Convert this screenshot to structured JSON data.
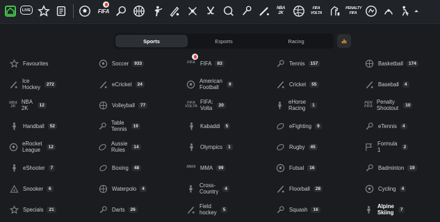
{
  "topbar": {
    "live_label": "LIVE",
    "nba_label": "NBA 2K",
    "fifa_label": "FIFA",
    "volta_label": "FIFA VOLTA",
    "penalty_label": "PENALTY FIFA"
  },
  "tabs": [
    {
      "label": "Sports",
      "active": true
    },
    {
      "label": "Esports",
      "active": false
    },
    {
      "label": "Racing",
      "active": false
    }
  ],
  "sports": [
    [
      {
        "name": "Favourites",
        "count": "",
        "icon": "star-icon"
      },
      {
        "name": "Ice Hockey",
        "count": "272",
        "icon": "ice-hockey-icon"
      },
      {
        "name": "NBA 2K",
        "count": "12",
        "icon": "nba-2k-icon"
      },
      {
        "name": "Handball",
        "count": "52",
        "icon": "handball-icon"
      },
      {
        "name": "eRocket League",
        "count": "12",
        "icon": "rocket-league-icon"
      },
      {
        "name": "eShooter",
        "count": "7",
        "icon": "shooter-icon"
      },
      {
        "name": "Snooker",
        "count": "6",
        "icon": "snooker-icon"
      },
      {
        "name": "Specials",
        "count": "21",
        "icon": "specials-icon"
      }
    ],
    [
      {
        "name": "Soccer",
        "count": "933",
        "icon": "soccer-icon"
      },
      {
        "name": "eCricket",
        "count": "24",
        "icon": "ecricket-icon"
      },
      {
        "name": "Volleyball",
        "count": "77",
        "icon": "volleyball-icon"
      },
      {
        "name": "Table Tennis",
        "count": "19",
        "icon": "table-tennis-icon"
      },
      {
        "name": "Aussie Rules",
        "count": "14",
        "icon": "aussie-rules-icon"
      },
      {
        "name": "Boxing",
        "count": "48",
        "icon": "boxing-icon"
      },
      {
        "name": "Waterpolo",
        "count": "4",
        "icon": "waterpolo-icon"
      },
      {
        "name": "Darts",
        "count": "26",
        "icon": "darts-icon"
      }
    ],
    [
      {
        "name": "FIFA",
        "count": "83",
        "icon": "fifa-icon"
      },
      {
        "name": "American Football",
        "count": "9",
        "icon": "american-football-icon"
      },
      {
        "name": "FIFA: Volta",
        "count": "20",
        "icon": "fifa-volta-icon"
      },
      {
        "name": "Kabaddi",
        "count": "5",
        "icon": "kabaddi-icon"
      },
      {
        "name": "Olympics",
        "count": "1",
        "icon": "olympics-icon"
      },
      {
        "name": "MMA",
        "count": "99",
        "icon": "mma-icon"
      },
      {
        "name": "Cross-Country",
        "count": "4",
        "icon": "cross-country-icon"
      },
      {
        "name": "Field hockey",
        "count": "5",
        "icon": "field-hockey-icon"
      }
    ],
    [
      {
        "name": "Tennis",
        "count": "157",
        "icon": "tennis-icon"
      },
      {
        "name": "Cricket",
        "count": "55",
        "icon": "cricket-icon"
      },
      {
        "name": "eHorse Racing",
        "count": "1",
        "icon": "horse-racing-icon"
      },
      {
        "name": "eFighting",
        "count": "9",
        "icon": "efighting-icon"
      },
      {
        "name": "Rugby",
        "count": "45",
        "icon": "rugby-icon"
      },
      {
        "name": "Futsal",
        "count": "16",
        "icon": "futsal-icon"
      },
      {
        "name": "Floorball",
        "count": "28",
        "icon": "floorball-icon"
      },
      {
        "name": "Squash",
        "count": "16",
        "icon": "squash-icon"
      }
    ],
    [
      {
        "name": "Basketball",
        "count": "174",
        "icon": "basketball-icon"
      },
      {
        "name": "Baseball",
        "count": "4",
        "icon": "baseball-icon"
      },
      {
        "name": "Penalty Shootout",
        "count": "10",
        "icon": "penalty-shootout-icon"
      },
      {
        "name": "eTennis",
        "count": "4",
        "icon": "etennis-icon"
      },
      {
        "name": "Formula 1",
        "count": "2",
        "icon": "formula-1-icon"
      },
      {
        "name": "Badminton",
        "count": "19",
        "icon": "badminton-icon"
      },
      {
        "name": "Cycling",
        "count": "4",
        "icon": "cycling-icon"
      },
      {
        "name": "Alpine Skiing",
        "count": "7",
        "icon": "alpine-skiing-icon"
      }
    ]
  ],
  "colors": {
    "accent_green": "#45c24c",
    "fire": "#e63d2e"
  }
}
